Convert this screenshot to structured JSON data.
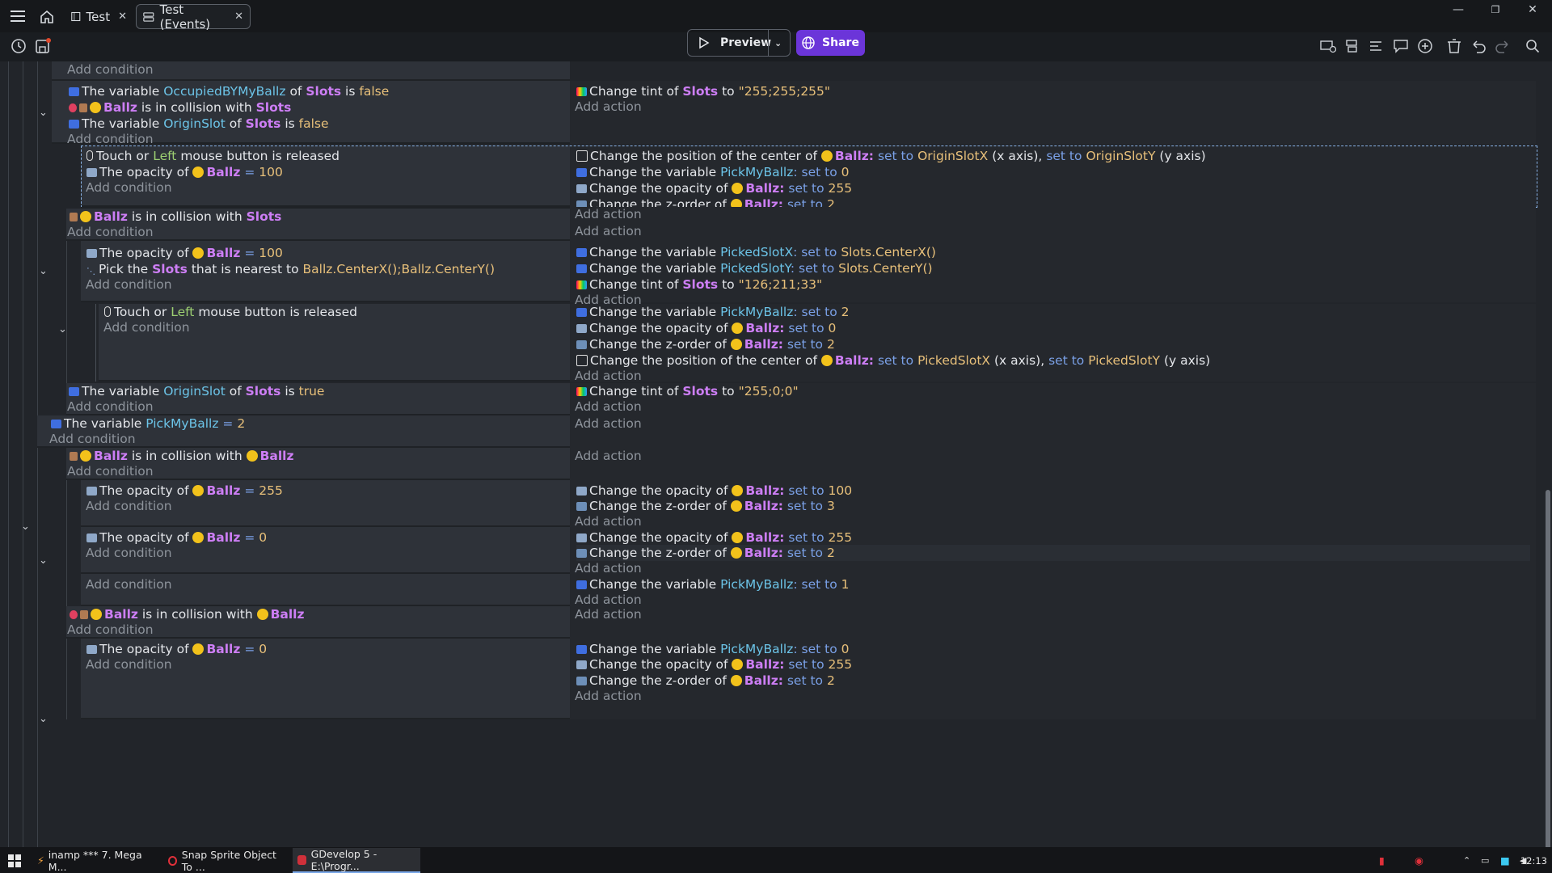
{
  "titlebar": {
    "tabs": [
      {
        "label": "Test"
      },
      {
        "label": "Test (Events)"
      }
    ],
    "close_glyph": "✕"
  },
  "toolbar": {
    "preview_label": "Preview",
    "share_label": "Share"
  },
  "events": {
    "add_condition": "Add condition",
    "add_action": "Add action",
    "c1_tail": "of",
    "row_a": {
      "cond1": {
        "pre": "The variable",
        "var": "OccupiedBYMyBallz",
        "mid": "of",
        "obj": "Slots",
        "is": "is",
        "val": "false"
      },
      "cond2": {
        "obj": "Ballz",
        "mid": "is in collision with",
        "obj2": "Slots"
      },
      "cond3": {
        "pre": "The variable",
        "var": "OriginSlot",
        "mid": "of",
        "obj": "Slots",
        "is": "is",
        "val": "false"
      },
      "act1": {
        "pre": "Change tint of",
        "obj": "Slots",
        "mid": "to",
        "val": "\"255;255;255\""
      }
    },
    "row_b": {
      "cond1": {
        "pre": "Touch or",
        "key": "Left",
        "post": "mouse button is released"
      },
      "cond2": {
        "pre": "The opacity of",
        "obj": "Ballz",
        "op": "=",
        "val": "100"
      },
      "act1": {
        "pre": "Change the position of the center of",
        "obj": "Ballz:",
        "set1": "set to",
        "v1": "OriginSlotX",
        "ax1": "(x axis),",
        "set2": "set to",
        "v2": "OriginSlotY",
        "ax2": "(y axis)"
      },
      "act2": {
        "pre": "Change the variable",
        "var": "PickMyBallz",
        "set": ": set to",
        "val": "0"
      },
      "act3": {
        "pre": "Change the opacity of",
        "obj": "Ballz:",
        "set": "set to",
        "val": "255"
      },
      "act4": {
        "pre": "Change the z-order of",
        "obj": "Ballz:",
        "set": "set to",
        "val": "2"
      }
    },
    "row_c": {
      "cond1": {
        "obj": "Ballz",
        "mid": "is in collision with",
        "obj2": "Slots"
      }
    },
    "row_d": {
      "cond1": {
        "pre": "The opacity of",
        "obj": "Ballz",
        "op": "=",
        "val": "100"
      },
      "cond2": {
        "pre": "Pick the",
        "obj": "Slots",
        "mid": "that is nearest to",
        "val": "Ballz.CenterX();Ballz.CenterY()"
      },
      "act1": {
        "pre": "Change the variable",
        "var": "PickedSlotX",
        "set": ": set to",
        "val": "Slots.CenterX()"
      },
      "act2": {
        "pre": "Change the variable",
        "var": "PickedSlotY",
        "set": ": set to",
        "val": "Slots.CenterY()"
      },
      "act3": {
        "pre": "Change tint of",
        "obj": "Slots",
        "mid": "to",
        "val": "\"126;211;33\""
      }
    },
    "row_e": {
      "cond1": {
        "pre": "Touch or",
        "key": "Left",
        "post": "mouse button is released"
      },
      "act1": {
        "pre": "Change the variable",
        "var": "PickMyBallz",
        "set": ": set to",
        "val": "2"
      },
      "act2": {
        "pre": "Change the opacity of",
        "obj": "Ballz:",
        "set": "set to",
        "val": "0"
      },
      "act3": {
        "pre": "Change the z-order of",
        "obj": "Ballz:",
        "set": "set to",
        "val": "2"
      },
      "act4": {
        "pre": "Change the position of the center of",
        "obj": "Ballz:",
        "set1": "set to",
        "v1": "PickedSlotX",
        "ax1": "(x axis),",
        "set2": "set to",
        "v2": "PickedSlotY",
        "ax2": "(y axis)"
      }
    },
    "row_f": {
      "cond1": {
        "pre": "The variable",
        "var": "OriginSlot",
        "mid": "of",
        "obj": "Slots",
        "is": "is",
        "val": "true"
      },
      "act1": {
        "pre": "Change tint of",
        "obj": "Slots",
        "mid": "to",
        "val": "\"255;0;0\""
      }
    },
    "row_g": {
      "cond1": {
        "pre": "The variable",
        "var": "PickMyBallz",
        "op": "=",
        "val": "2"
      }
    },
    "row_h": {
      "cond1": {
        "obj": "Ballz",
        "mid": "is in collision with",
        "obj2": "Ballz"
      }
    },
    "row_i": {
      "cond1": {
        "pre": "The opacity of",
        "obj": "Ballz",
        "op": "=",
        "val": "255"
      },
      "act1": {
        "pre": "Change the opacity of",
        "obj": "Ballz:",
        "set": "set to",
        "val": "100"
      },
      "act2": {
        "pre": "Change the z-order of",
        "obj": "Ballz:",
        "set": "set to",
        "val": "3"
      }
    },
    "row_j": {
      "cond1": {
        "pre": "The opacity of",
        "obj": "Ballz",
        "op": "=",
        "val": "0"
      },
      "act1": {
        "pre": "Change the opacity of",
        "obj": "Ballz:",
        "set": "set to",
        "val": "255"
      },
      "act2": {
        "pre": "Change the z-order of",
        "obj": "Ballz:",
        "set": "set to",
        "val": "2"
      }
    },
    "row_k": {
      "act1": {
        "pre": "Change the variable",
        "var": "PickMyBallz",
        "set": ": set to",
        "val": "1"
      }
    },
    "row_l": {
      "cond1": {
        "obj": "Ballz",
        "mid": "is in collision with",
        "obj2": "Ballz"
      }
    },
    "row_m": {
      "cond1": {
        "pre": "The opacity of",
        "obj": "Ballz",
        "op": "=",
        "val": "0"
      },
      "act1": {
        "pre": "Change the variable",
        "var": "PickMyBallz",
        "set": ": set to",
        "val": "0"
      },
      "act2": {
        "pre": "Change the opacity of",
        "obj": "Ballz:",
        "set": "set to",
        "val": "255"
      },
      "act3": {
        "pre": "Change the z-order of",
        "obj": "Ballz:",
        "set": "set to",
        "val": "2"
      }
    }
  },
  "taskbar": {
    "tasks": [
      {
        "label": "inamp *** 7. Mega M..."
      },
      {
        "label": "Snap Sprite Object To ..."
      },
      {
        "label": "GDevelop 5 - E:\\Progr..."
      }
    ],
    "clock": "12:13"
  },
  "colors": {
    "accent": "#6b35d9",
    "object": "#cd7ef5",
    "variable": "#6cc4e8",
    "value": "#e8c07a"
  }
}
